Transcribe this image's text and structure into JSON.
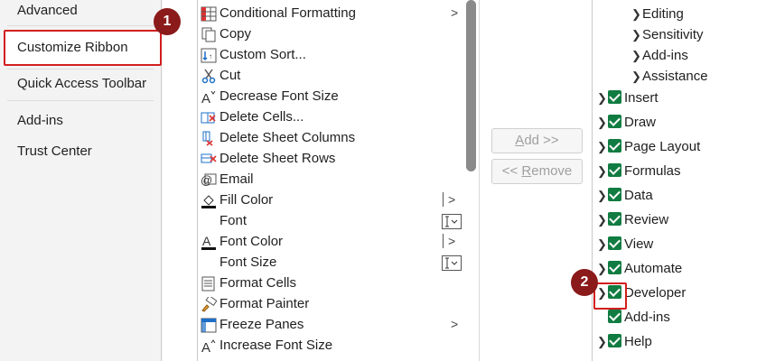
{
  "nav": {
    "items": [
      {
        "label": "Advanced"
      },
      {
        "label": "Customize Ribbon"
      },
      {
        "label": "Quick Access Toolbar"
      },
      {
        "label": "Add-ins"
      },
      {
        "label": "Trust Center"
      }
    ]
  },
  "commands": [
    {
      "label": "Conditional Formatting",
      "icon": "conditional-formatting-icon",
      "arrow": ">"
    },
    {
      "label": "Copy",
      "icon": "copy-icon"
    },
    {
      "label": "Custom Sort...",
      "icon": "custom-sort-icon"
    },
    {
      "label": "Cut",
      "icon": "cut-icon"
    },
    {
      "label": "Decrease Font Size",
      "icon": "decrease-font-size-icon"
    },
    {
      "label": "Delete Cells...",
      "icon": "delete-cells-icon"
    },
    {
      "label": "Delete Sheet Columns",
      "icon": "delete-sheet-columns-icon"
    },
    {
      "label": "Delete Sheet Rows",
      "icon": "delete-sheet-rows-icon"
    },
    {
      "label": "Email",
      "icon": "email-icon"
    },
    {
      "label": "Fill Color",
      "icon": "fill-color-icon",
      "arrow": ">"
    },
    {
      "label": "Font",
      "icon": "",
      "arrow": ""
    },
    {
      "label": "Font Color",
      "icon": "font-color-icon",
      "arrow": ">"
    },
    {
      "label": "Font Size",
      "icon": "",
      "arrow": ""
    },
    {
      "label": "Format Cells",
      "icon": "format-cells-icon"
    },
    {
      "label": "Format Painter",
      "icon": "format-painter-icon"
    },
    {
      "label": "Freeze Panes",
      "icon": "freeze-panes-icon",
      "arrow": ">"
    },
    {
      "label": "Increase Font Size",
      "icon": "increase-font-size-icon"
    }
  ],
  "buttons": {
    "add_prefix": "",
    "add_underlined": "A",
    "add_rest": "dd >>",
    "remove_prefix": "<< ",
    "remove_underlined": "R",
    "remove_rest": "emove"
  },
  "tree": {
    "groups": [
      {
        "label": "Editing"
      },
      {
        "label": "Sensitivity"
      },
      {
        "label": "Add-ins"
      },
      {
        "label": "Assistance"
      }
    ],
    "tabs": [
      {
        "label": "Insert",
        "checked": true
      },
      {
        "label": "Draw",
        "checked": true
      },
      {
        "label": "Page Layout",
        "checked": true
      },
      {
        "label": "Formulas",
        "checked": true
      },
      {
        "label": "Data",
        "checked": true
      },
      {
        "label": "Review",
        "checked": true
      },
      {
        "label": "View",
        "checked": true
      },
      {
        "label": "Automate",
        "checked": true
      },
      {
        "label": "Developer",
        "checked": true
      },
      {
        "label": "Add-ins",
        "checked": true
      },
      {
        "label": "Help",
        "checked": true
      }
    ]
  },
  "markers": {
    "one": "1",
    "two": "2"
  },
  "colors": {
    "accent_red": "#d21e1e",
    "marker": "#8b1a1a",
    "check_green": "#107c41"
  }
}
